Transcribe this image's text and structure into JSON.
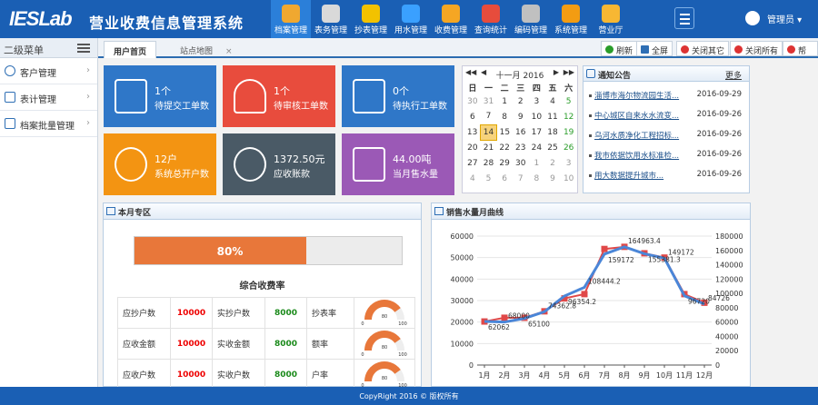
{
  "app": {
    "logo": "IESLab",
    "title": "营业收费信息管理系统",
    "user": "管理员"
  },
  "nav": [
    {
      "label": "档案管理",
      "icon": "archive-icon",
      "color": "#f0a830",
      "active": true
    },
    {
      "label": "表务管理",
      "icon": "gauge-icon",
      "color": "#d9d9d9",
      "active": false
    },
    {
      "label": "抄表管理",
      "icon": "worker-icon",
      "color": "#f2c200",
      "active": false
    },
    {
      "label": "用水管理",
      "icon": "water-drop-icon",
      "color": "#3aa0ff",
      "active": false
    },
    {
      "label": "收费管理",
      "icon": "coins-icon",
      "color": "#f5a623",
      "active": false
    },
    {
      "label": "查询统计",
      "icon": "bar-chart-icon",
      "color": "#e74c3c",
      "active": false
    },
    {
      "label": "编码管理",
      "icon": "tools-icon",
      "color": "#c0c0c0",
      "active": false
    },
    {
      "label": "系统管理",
      "icon": "gear-icon",
      "color": "#f39c12",
      "active": false
    },
    {
      "label": "营业厅",
      "icon": "building-icon",
      "color": "#f7b733",
      "active": false
    }
  ],
  "sidebar": {
    "title": "二级菜单",
    "items": [
      {
        "label": "客户管理"
      },
      {
        "label": "表计管理"
      },
      {
        "label": "档案批量管理"
      }
    ]
  },
  "tabs": [
    {
      "label": "用户首页"
    },
    {
      "label": "站点地图"
    }
  ],
  "toolbar": {
    "refresh": "刷新",
    "fullscreen": "全屏",
    "close_others": "关闭其它",
    "close_all": "关闭所有",
    "help": "帮助"
  },
  "tiles": [
    {
      "value": "1个",
      "label": "待提交工单数",
      "color": "#2f77c8",
      "icon": "clipboard-clock-icon"
    },
    {
      "value": "1个",
      "label": "待审核工单数",
      "color": "#e84c3d",
      "icon": "bell-icon"
    },
    {
      "value": "0个",
      "label": "待执行工单数",
      "color": "#2f77c8",
      "icon": "clipboard-clock-icon"
    },
    {
      "value": "12户",
      "label": "系统总开户数",
      "color": "#f39412",
      "icon": "users-icon"
    },
    {
      "value": "1372.50元",
      "label": "应收账款",
      "color": "#4a5a66",
      "icon": "yen-icon"
    },
    {
      "value": "44.00吨",
      "label": "当月售水量",
      "color": "#9b59b6",
      "icon": "list-icon"
    }
  ],
  "calendar": {
    "month": "十一月 2016",
    "weekdays": [
      "日",
      "一",
      "二",
      "三",
      "四",
      "五",
      "六"
    ],
    "rows": [
      [
        "30",
        "31",
        "1",
        "2",
        "3",
        "4",
        "5"
      ],
      [
        "6",
        "7",
        "8",
        "9",
        "10",
        "11",
        "12"
      ],
      [
        "13",
        "14",
        "15",
        "16",
        "17",
        "18",
        "19"
      ],
      [
        "20",
        "21",
        "22",
        "23",
        "24",
        "25",
        "26"
      ],
      [
        "27",
        "28",
        "29",
        "30",
        "1",
        "2",
        "3"
      ],
      [
        "4",
        "5",
        "6",
        "7",
        "8",
        "9",
        "10"
      ]
    ],
    "today": "14"
  },
  "notice": {
    "title": "通知公告",
    "more": "更多",
    "items": [
      {
        "title": "淄博市海尔物流园生活...",
        "date": "2016-09-29"
      },
      {
        "title": "中心城区自来水水流变...",
        "date": "2016-09-26"
      },
      {
        "title": "乌河水质净化工程招标...",
        "date": "2016-09-26"
      },
      {
        "title": "我市依据饮用水标准检...",
        "date": "2016-09-26"
      },
      {
        "title": "用大数据提升城市...",
        "date": "2016-09-26"
      }
    ]
  },
  "month_panel": {
    "title": "本月专区",
    "progress_pct": 80,
    "progress_label": "80%",
    "rate_title": "综合收费率",
    "rows": [
      {
        "a_label": "应抄户数",
        "a_val": "10000",
        "b_label": "实抄户数",
        "b_val": "8000",
        "c_label": "抄表率",
        "gauge_pct": 80,
        "gmin": "0",
        "gmid": "80",
        "gmax": "100"
      },
      {
        "a_label": "应收金额",
        "a_val": "10000",
        "b_label": "实收金额",
        "b_val": "8000",
        "c_label": "额率",
        "gauge_pct": 80,
        "gmin": "0",
        "gmid": "80",
        "gmax": "100"
      },
      {
        "a_label": "应收户数",
        "a_val": "10000",
        "b_label": "实收户数",
        "b_val": "8000",
        "c_label": "户率",
        "gauge_pct": 80,
        "gmin": "0",
        "gmid": "80",
        "gmax": "100"
      }
    ]
  },
  "chart_panel": {
    "title": "销售水量月曲线"
  },
  "chart_data": {
    "type": "line",
    "categories": [
      "1月",
      "2月",
      "3月",
      "4月",
      "5月",
      "6月",
      "7月",
      "8月",
      "9月",
      "10月",
      "11月",
      "12月"
    ],
    "series": [
      {
        "values": [
          20262,
          22000,
          22000,
          25000,
          31000,
          33000,
          54000,
          55000,
          52000,
          50000,
          33000,
          29000
        ],
        "color": "#e04848"
      },
      {
        "values": [
          20262,
          20000,
          21700,
          24787,
          32118,
          36150,
          51600,
          54988,
          51794,
          49724,
          32240,
          28375
        ],
        "color": "#4a86d8"
      }
    ],
    "labels": [
      "62062",
      "68000",
      "65100",
      "74362.8",
      "96354.2",
      "108444.2",
      "159172",
      "164963.4",
      "155381.3",
      "149172",
      "96720",
      "84726"
    ],
    "y_left": [
      0,
      10000,
      20000,
      30000,
      40000,
      50000,
      60000
    ],
    "y_right": [
      0,
      20000,
      40000,
      60000,
      80000,
      100000,
      120000,
      140000,
      160000,
      180000
    ]
  },
  "footer": "CopyRight 2016 © 版权所有"
}
